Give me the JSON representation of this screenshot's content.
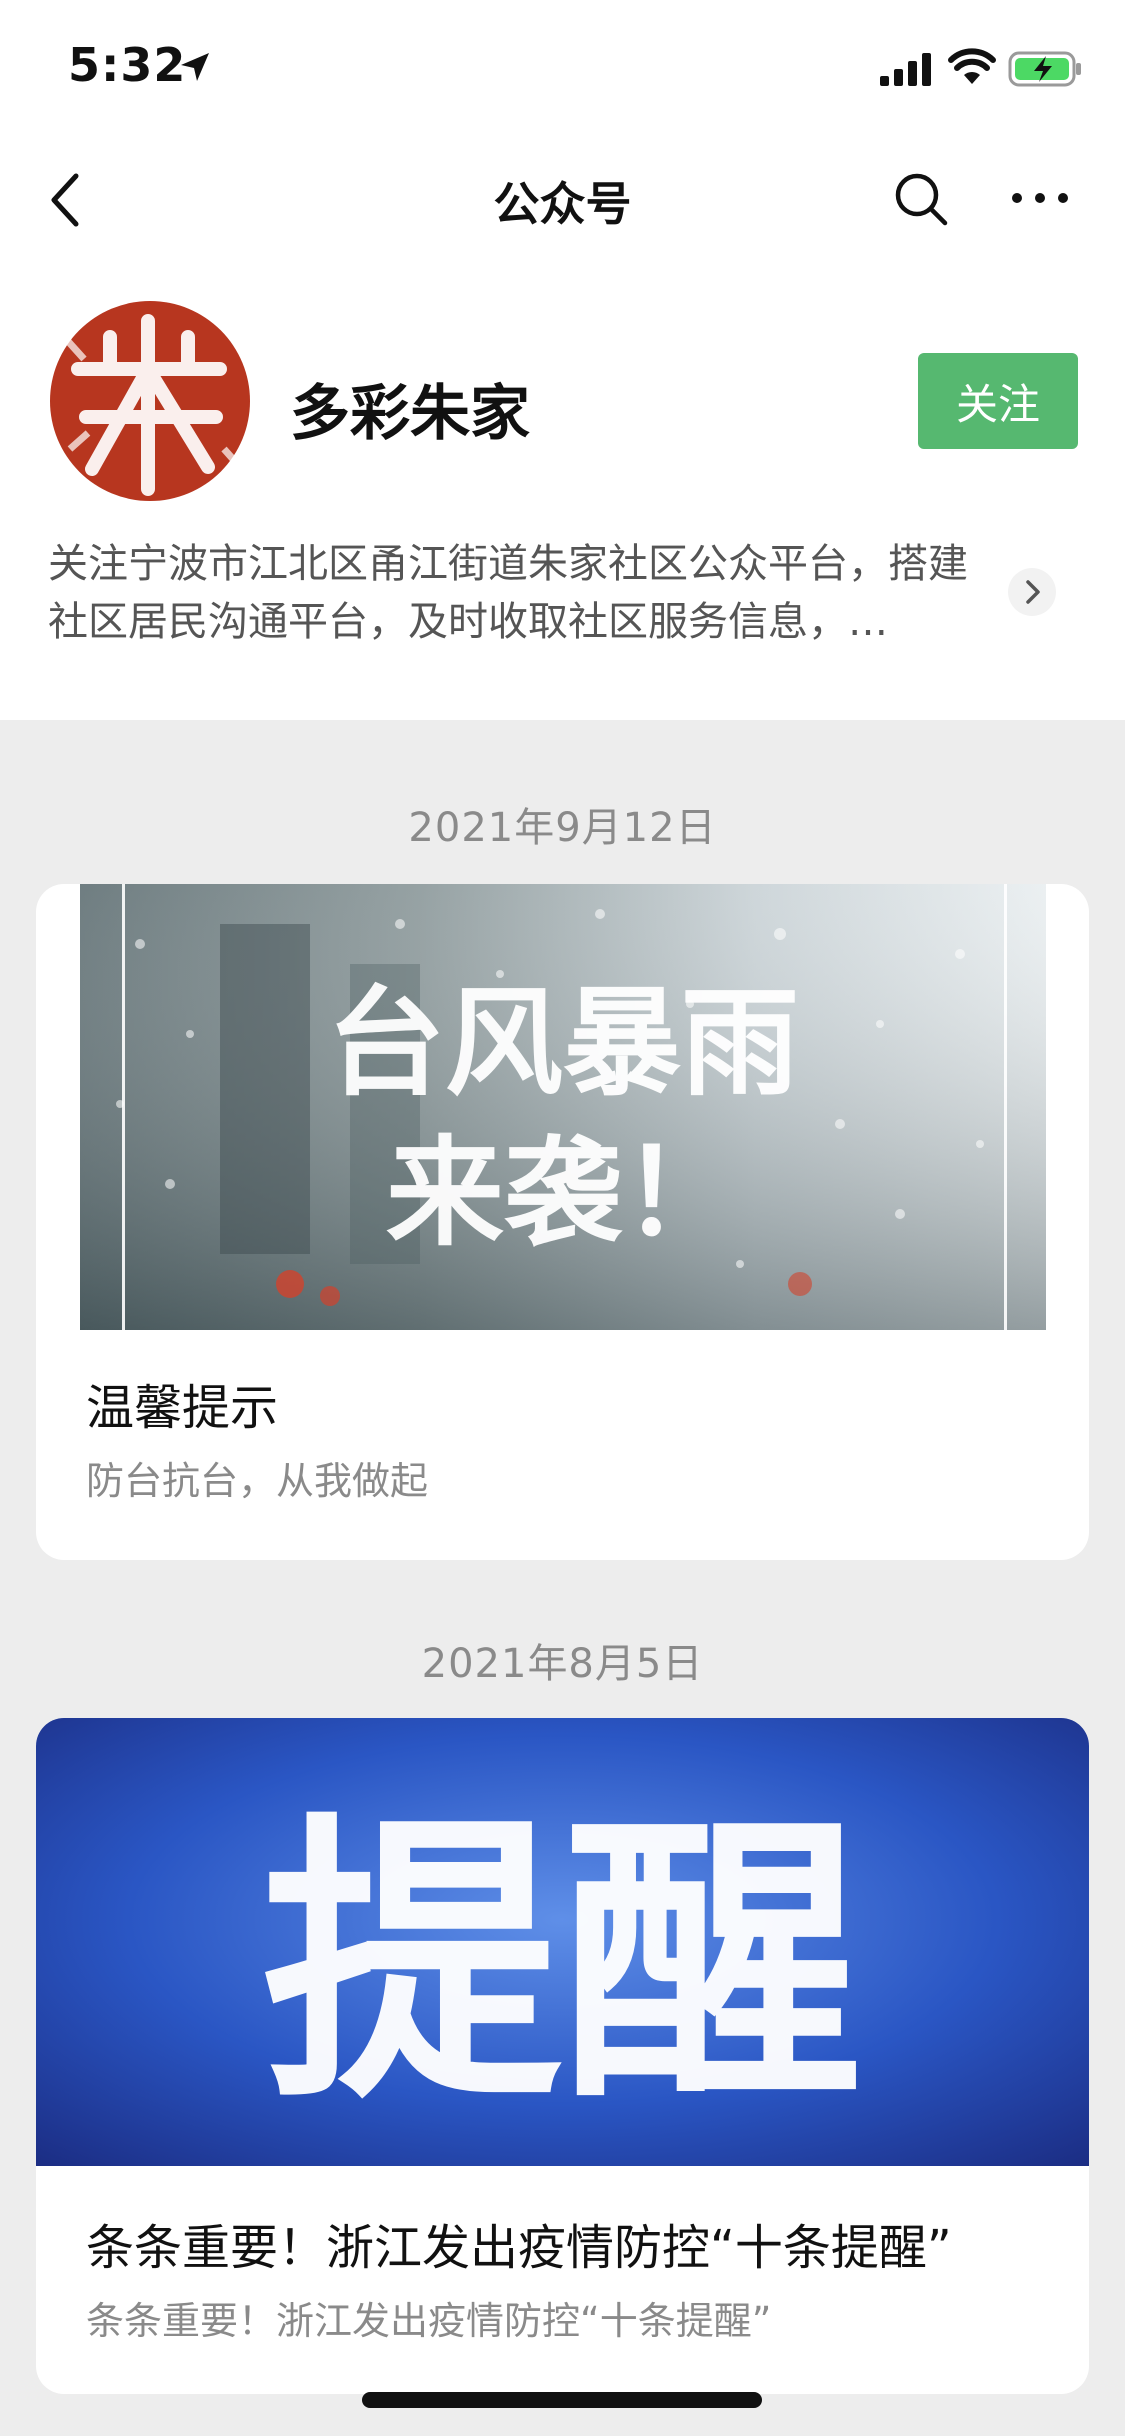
{
  "status_bar": {
    "time": "5:32"
  },
  "nav": {
    "title": "公众号"
  },
  "account": {
    "name": "多彩朱家",
    "follow_label": "关注",
    "description": "关注宁波市江北区甬江街道朱家社区公众平台，搭建社区居民沟通平台，及时收取社区服务信息，…"
  },
  "articles": [
    {
      "date": "2021年9月12日",
      "image_text_line1": "台风暴雨",
      "image_text_line2": "来袭！",
      "title": "温馨提示",
      "subtitle": "防台抗台，从我做起"
    },
    {
      "date": "2021年8月5日",
      "image_text": "提醒",
      "title": "条条重要！浙江发出疫情防控“十条提醒”",
      "subtitle": "条条重要！浙江发出疫情防控“十条提醒”"
    }
  ],
  "colors": {
    "follow_button": "#56b870",
    "avatar_seal": "#b7361f",
    "banner_blue": "#1d3a9a"
  },
  "icons": [
    "location-arrow-icon",
    "signal-icon",
    "wifi-icon",
    "battery-charging-icon",
    "back-icon",
    "search-icon",
    "more-icon",
    "chevron-right-icon"
  ]
}
